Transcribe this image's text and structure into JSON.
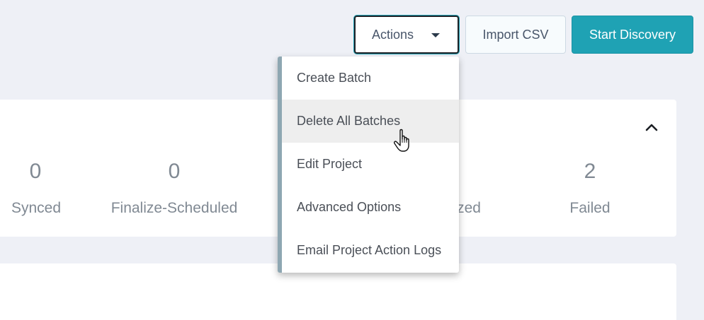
{
  "toolbar": {
    "actions_label": "Actions",
    "import_label": "Import CSV",
    "start_label": "Start Discovery",
    "accent_color": "#1fa2b4"
  },
  "actions_menu": {
    "items": [
      {
        "label": "Create Batch"
      },
      {
        "label": "Delete All Batches",
        "hovered": true
      },
      {
        "label": "Edit Project"
      },
      {
        "label": "Advanced Options"
      },
      {
        "label": "Email Project Action Logs"
      }
    ]
  },
  "stats": [
    {
      "value": "0",
      "label": "Synced"
    },
    {
      "value": "0",
      "label": "Finalize-Scheduled"
    },
    {
      "value": "",
      "label": "zed"
    },
    {
      "value": "2",
      "label": "Failed"
    }
  ],
  "icons": {
    "actions_caret": "caret-down-icon",
    "collapse": "chevron-up-icon",
    "pointer": "hand-pointer-cursor-icon"
  }
}
